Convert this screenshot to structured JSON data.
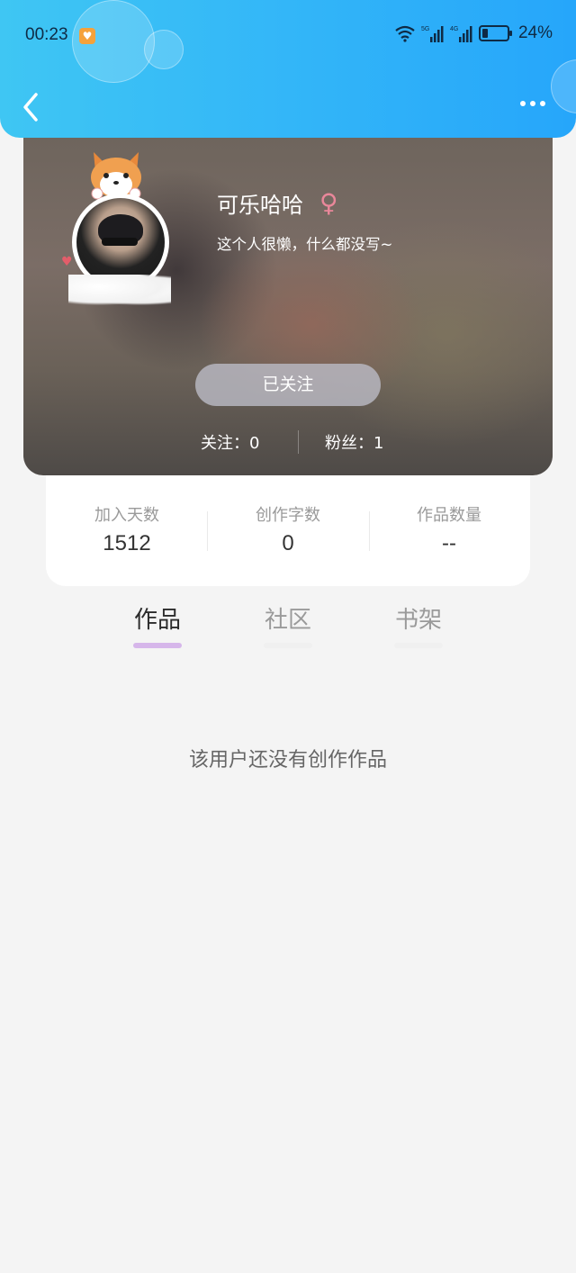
{
  "status_bar": {
    "time": "00:23",
    "battery": "24%",
    "battery_level_fraction": 0.24,
    "signal_5g_label": "5G",
    "signal_4g_label": "4G"
  },
  "profile": {
    "nickname": "可乐哈哈",
    "gender_symbol": "♀",
    "bio": "这个人很懒，什么都没写~",
    "follow_button": "已关注",
    "following": "关注：0",
    "fans": "粉丝：1"
  },
  "stats": [
    {
      "label": "加入天数",
      "value": "1512"
    },
    {
      "label": "创作字数",
      "value": "0"
    },
    {
      "label": "作品数量",
      "value": "--"
    }
  ],
  "tabs": [
    {
      "label": "作品",
      "active": true
    },
    {
      "label": "社区",
      "active": false
    },
    {
      "label": "书架",
      "active": false
    }
  ],
  "empty_message": "该用户还没有创作作品",
  "colors": {
    "header_start": "#3fc6f3",
    "header_end": "#26a6fa",
    "tab_indicator": "#d6b6ea",
    "gender": "#e9879a"
  }
}
